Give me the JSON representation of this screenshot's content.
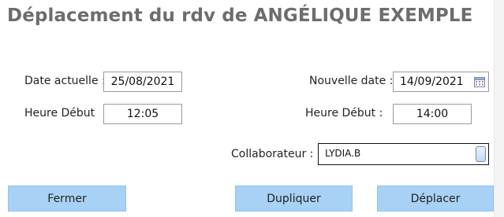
{
  "dialog": {
    "title": "Déplacement du rdv de ANGÉLIQUE EXEMPLE"
  },
  "current": {
    "date_label": "Date actuelle :",
    "date_value": "25/08/2021",
    "time_label": "Heure Début",
    "time_value": "12:05"
  },
  "new": {
    "date_label": "Nouvelle date :",
    "date_value": "14/09/2021",
    "time_label": "Heure Début :",
    "time_value": "14:00"
  },
  "collaborator": {
    "label": "Collaborateur :",
    "selected": "LYDIA.B"
  },
  "buttons": {
    "close": "Fermer",
    "duplicate": "Dupliquer",
    "move": "Déplacer"
  },
  "icons": {
    "calendar": "calendar-icon",
    "dropdown": "dropdown-arrow-icon"
  },
  "colors": {
    "button_bg": "#a7d2f5",
    "title": "#6d6d6d"
  }
}
